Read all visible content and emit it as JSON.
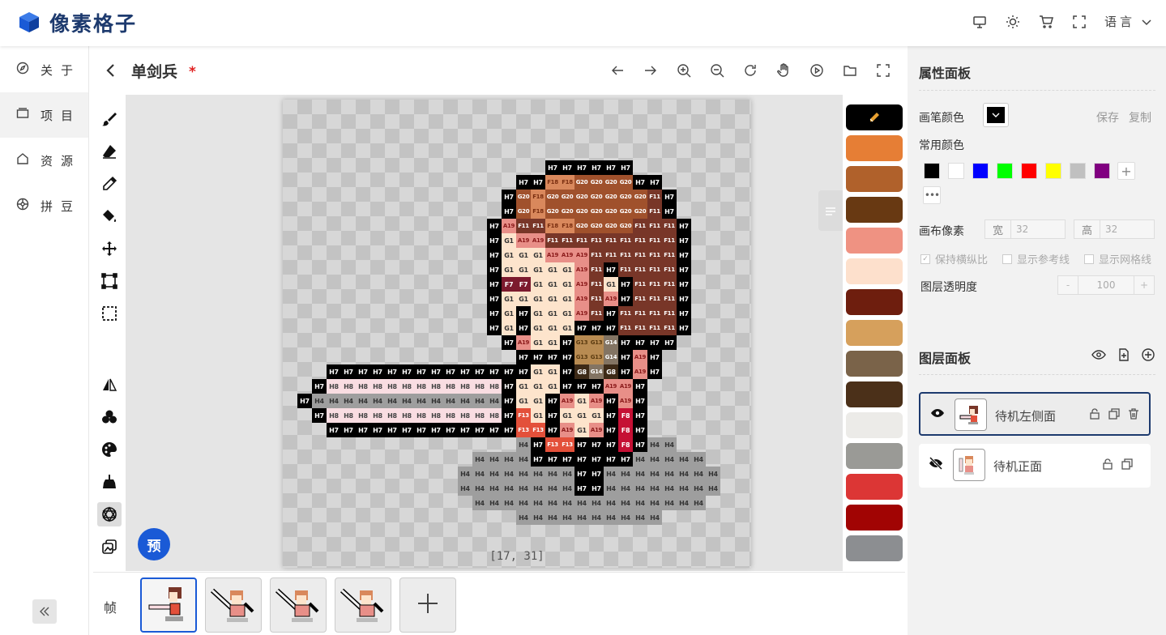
{
  "app": {
    "title": "像素格子"
  },
  "topbar": {
    "icons": [
      "monitor-icon",
      "sun-icon",
      "cart-icon",
      "fullscreen-icon"
    ],
    "language_label": "语言"
  },
  "nav": {
    "items": [
      {
        "label": "关于",
        "icon": "compass-icon"
      },
      {
        "label": "项目",
        "icon": "folder-icon"
      },
      {
        "label": "资源",
        "icon": "home-icon"
      },
      {
        "label": "拼豆",
        "icon": "bead-icon"
      }
    ],
    "active": 1
  },
  "project": {
    "title": "单剑兵",
    "required_mark": "*"
  },
  "header_tools": [
    "undo-icon",
    "redo-icon",
    "zoom-in-icon",
    "zoom-out-icon",
    "refresh-icon",
    "hand-icon",
    "play-icon",
    "folder-open-icon",
    "fullscreen-icon"
  ],
  "tools": [
    "brush-icon",
    "eraser-icon",
    "eyedropper-icon",
    "bucket-icon",
    "move-icon",
    "crop-icon",
    "select-icon",
    "mirror-icon",
    "cluster-icon",
    "palette-icon",
    "broom-icon",
    "hexagon-icon",
    "layers-icon"
  ],
  "active_tool": "hexagon-icon",
  "canvas": {
    "coords": "[17, 31]",
    "width": 32,
    "height": 32
  },
  "preview_label": "预",
  "palette": {
    "selected": "#000000",
    "colors": [
      "#000000",
      "#e67e35",
      "#b0612b",
      "#683912",
      "#ef9282",
      "#fde0cc",
      "#6e1e0e",
      "#d6a05c",
      "#7a6349",
      "#4b3019",
      "#ecebe8",
      "#9a9a96",
      "#dc3635",
      "#a10403",
      "#8c8e91"
    ]
  },
  "pixel_colors": {
    "H7": {
      "bg": "#000000",
      "fg": "#ffffff"
    },
    "H8": {
      "bg": "#f9dde2",
      "fg": "#444444"
    },
    "H4": {
      "bg": "#9e9e9e",
      "fg": "#333333"
    },
    "F18": {
      "bg": "#d9885c",
      "fg": "#7a2e10"
    },
    "G20": {
      "bg": "#a0512c",
      "fg": "#ffffff"
    },
    "F11": {
      "bg": "#783628",
      "fg": "#ffffff"
    },
    "A19": {
      "bg": "#e88f88",
      "fg": "#8a1a1a"
    },
    "G1": {
      "bg": "#fde4cc",
      "fg": "#333333"
    },
    "F7": {
      "bg": "#7c1a2e",
      "fg": "#ffffff"
    },
    "G13": {
      "bg": "#b88b52",
      "fg": "#5a3a10"
    },
    "G14": {
      "bg": "#837463",
      "fg": "#ffffff"
    },
    "G8": {
      "bg": "#3d2a17",
      "fg": "#ffffff"
    },
    "F13": {
      "bg": "#e3503a",
      "fg": "#ffffff"
    },
    "F8": {
      "bg": "#c51034",
      "fg": "#ffffff"
    }
  },
  "pixel_rows": [
    {
      "y": 4,
      "x": 18,
      "c": [
        "H7",
        "H7",
        "H7",
        "H7",
        "H7",
        "H7"
      ]
    },
    {
      "y": 5,
      "x": 16,
      "c": [
        "H7",
        "H7",
        "F18",
        "F18",
        "G20",
        "G20",
        "G20",
        "G20",
        "H7",
        "H7"
      ]
    },
    {
      "y": 6,
      "x": 15,
      "c": [
        "H7",
        "G20",
        "F18",
        "G20",
        "G20",
        "G20",
        "G20",
        "G20",
        "G20",
        "G20",
        "F11",
        "H7"
      ]
    },
    {
      "y": 7,
      "x": 15,
      "c": [
        "H7",
        "G20",
        "F18",
        "G20",
        "G20",
        "G20",
        "G20",
        "G20",
        "G20",
        "G20",
        "F11",
        "H7"
      ]
    },
    {
      "y": 8,
      "x": 14,
      "c": [
        "H7",
        "A19",
        "F11",
        "F11",
        "F18",
        "F18",
        "G20",
        "G20",
        "G20",
        "G20",
        "F11",
        "F11",
        "F11",
        "H7"
      ]
    },
    {
      "y": 9,
      "x": 14,
      "c": [
        "H7",
        "G1",
        "A19",
        "A19",
        "F11",
        "F11",
        "F11",
        "F11",
        "F11",
        "F11",
        "F11",
        "F11",
        "F11",
        "H7"
      ]
    },
    {
      "y": 10,
      "x": 14,
      "c": [
        "H7",
        "G1",
        "G1",
        "G1",
        "A19",
        "A19",
        "A19",
        "F11",
        "F11",
        "F11",
        "F11",
        "F11",
        "F11",
        "H7"
      ]
    },
    {
      "y": 11,
      "x": 14,
      "c": [
        "H7",
        "G1",
        "G1",
        "G1",
        "G1",
        "G1",
        "A19",
        "F11",
        "H7",
        "F11",
        "F11",
        "F11",
        "F11",
        "H7"
      ]
    },
    {
      "y": 12,
      "x": 14,
      "c": [
        "H7",
        "F7",
        "F7",
        "G1",
        "G1",
        "G1",
        "A19",
        "F11",
        "G1",
        "H7",
        "F11",
        "F11",
        "F11",
        "H7"
      ]
    },
    {
      "y": 13,
      "x": 14,
      "c": [
        "H7",
        "G1",
        "G1",
        "G1",
        "G1",
        "G1",
        "A19",
        "F11",
        "A19",
        "H7",
        "F11",
        "F11",
        "F11",
        "H7"
      ]
    },
    {
      "y": 14,
      "x": 14,
      "c": [
        "H7",
        "G1",
        "H7",
        "G1",
        "G1",
        "G1",
        "A19",
        "F11",
        "H7",
        "F11",
        "F11",
        "F11",
        "F11",
        "H7"
      ]
    },
    {
      "y": 15,
      "x": 14,
      "c": [
        "H7",
        "G1",
        "H7",
        "G1",
        "G1",
        "G1",
        "H7",
        "H7",
        "H7",
        "F11",
        "F11",
        "F11",
        "F11",
        "H7"
      ]
    },
    {
      "y": 16,
      "x": 15,
      "c": [
        "H7",
        "A19",
        "G1",
        "G1",
        "H7",
        "G13",
        "G13",
        "G14",
        "H7",
        "H7",
        "H7",
        "H7"
      ]
    },
    {
      "y": 17,
      "x": 16,
      "c": [
        "H7",
        "H7",
        "H7",
        "H7",
        "G13",
        "G13",
        "G14",
        "H7",
        "A19",
        "H7"
      ]
    },
    {
      "y": 18,
      "x": 3,
      "c": [
        "H7",
        "H7",
        "H7",
        "H7",
        "H7",
        "H7",
        "H7",
        "H7",
        "H7",
        "H7",
        "H7",
        "H7",
        "H7",
        "H7",
        "G1",
        "G1",
        "H7",
        "G8",
        "G14",
        "G8",
        "H7",
        "A19",
        "H7"
      ]
    },
    {
      "y": 19,
      "x": 2,
      "c": [
        "H7",
        "H8",
        "H8",
        "H8",
        "H8",
        "H8",
        "H8",
        "H8",
        "H8",
        "H8",
        "H8",
        "H8",
        "H8",
        "H7",
        "G1",
        "G1",
        "G1",
        "H7",
        "H7",
        "H7",
        "A19",
        "A19",
        "H7"
      ]
    },
    {
      "y": 20,
      "x": 1,
      "c": [
        "H7",
        "H4",
        "H4",
        "H4",
        "H4",
        "H4",
        "H4",
        "H4",
        "H4",
        "H4",
        "H4",
        "H4",
        "H4",
        "H4",
        "H7",
        "G1",
        "G1",
        "H7",
        "A19",
        "G1",
        "A19",
        "H7",
        "A19",
        "H7"
      ]
    },
    {
      "y": 21,
      "x": 2,
      "c": [
        "H7",
        "H8",
        "H8",
        "H8",
        "H8",
        "H8",
        "H8",
        "H8",
        "H8",
        "H8",
        "H8",
        "H8",
        "H8",
        "H7",
        "F13",
        "G1",
        "H7",
        "G1",
        "G1",
        "G1",
        "H7",
        "F8",
        "H7"
      ]
    },
    {
      "y": 22,
      "x": 3,
      "c": [
        "H7",
        "H7",
        "H7",
        "H7",
        "H7",
        "H7",
        "H7",
        "H7",
        "H7",
        "H7",
        "H7",
        "H7",
        "H7",
        "F13",
        "F13",
        "H7",
        "A19",
        "G1",
        "A19",
        "H7",
        "F8",
        "H7"
      ]
    },
    {
      "y": 23,
      "x": 16,
      "c": [
        "H4",
        "H7",
        "F13",
        "F13",
        "H7",
        "H7",
        "H7",
        "F8",
        "H7",
        "H4",
        "H4"
      ]
    },
    {
      "y": 24,
      "x": 13,
      "c": [
        "H4",
        "H4",
        "H4",
        "H4",
        "H7",
        "H7",
        "H7",
        "H7",
        "H7",
        "H7",
        "H7",
        "H4",
        "H4",
        "H4",
        "H4",
        "H4"
      ]
    },
    {
      "y": 25,
      "x": 12,
      "c": [
        "H4",
        "H4",
        "H4",
        "H4",
        "H4",
        "H4",
        "H4",
        "H4",
        "H7",
        "H7",
        "H4",
        "H4",
        "H4",
        "H4",
        "H4",
        "H4",
        "H4",
        "H4"
      ]
    },
    {
      "y": 26,
      "x": 12,
      "c": [
        "H4",
        "H4",
        "H4",
        "H4",
        "H4",
        "H4",
        "H4",
        "H4",
        "H7",
        "H7",
        "H4",
        "H4",
        "H4",
        "H4",
        "H4",
        "H4",
        "H4",
        "H4"
      ]
    },
    {
      "y": 27,
      "x": 13,
      "c": [
        "H4",
        "H4",
        "H4",
        "H4",
        "H4",
        "H4",
        "H4",
        "H4",
        "H4",
        "H4",
        "H4",
        "H4",
        "H4",
        "H4",
        "H4",
        "H4"
      ]
    },
    {
      "y": 28,
      "x": 16,
      "c": [
        "H4",
        "H4",
        "H4",
        "H4",
        "H4",
        "H4",
        "H4",
        "H4",
        "H4",
        "H4"
      ]
    }
  ],
  "frames": {
    "label": "帧",
    "count": 4,
    "active": 0,
    "add_icon": "plus-icon"
  },
  "props": {
    "title": "属性面板",
    "brush_label": "画笔颜色",
    "brush_color": "#000000",
    "save": "保存",
    "copy": "复制",
    "common_label": "常用颜色",
    "common_colors": [
      "#000000",
      "#ffffff",
      "#0000ff",
      "#00ff00",
      "#ff0000",
      "#ffff00",
      "#c0c0c0",
      "#800080"
    ],
    "canvas_px_label": "画布像素",
    "width_prefix": "宽",
    "width_val": "32",
    "height_prefix": "高",
    "height_val": "32",
    "keep_ratio": "保持横纵比",
    "show_ref": "显示参考线",
    "show_grid": "显示网格线",
    "opacity_label": "图层透明度",
    "opacity_val": "100"
  },
  "layers": {
    "title": "图层面板",
    "items": [
      {
        "name": "待机左侧面",
        "visible": true,
        "active": true
      },
      {
        "name": "待机正面",
        "visible": false,
        "active": false
      }
    ]
  }
}
